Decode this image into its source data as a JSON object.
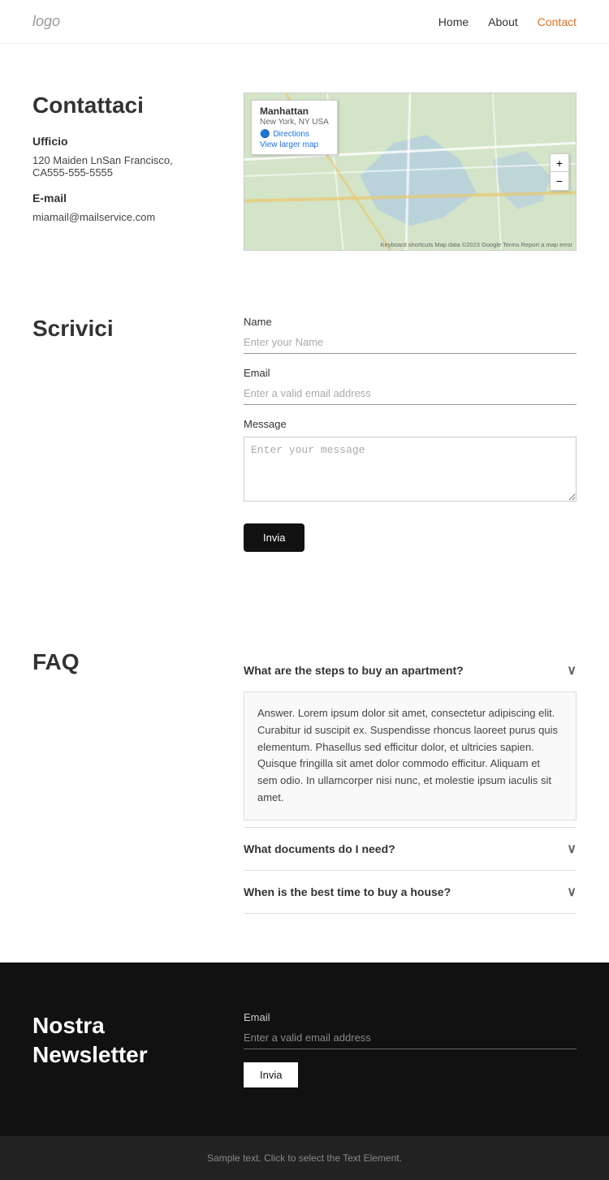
{
  "nav": {
    "logo": "logo",
    "links": [
      {
        "label": "Home",
        "href": "#",
        "active": false
      },
      {
        "label": "About",
        "href": "#",
        "active": false
      },
      {
        "label": "Contact",
        "href": "#",
        "active": true
      }
    ]
  },
  "contact": {
    "title": "Contattaci",
    "office_label": "Ufficio",
    "address": "120 Maiden LnSan Francisco, CA555-555-5555",
    "email_label": "E-mail",
    "email": "miamail@mailservice.com",
    "map": {
      "place": "Manhattan",
      "location": "New York, NY USA",
      "directions_label": "Directions",
      "view_larger": "View larger map",
      "zoom_in": "+",
      "zoom_out": "−",
      "footer": "Keyboard shortcuts  Map data ©2023 Google  Terms  Report a map error"
    }
  },
  "form": {
    "title": "Scrivici",
    "name_label": "Name",
    "name_placeholder": "Enter your Name",
    "email_label": "Email",
    "email_placeholder": "Enter a valid email address",
    "message_label": "Message",
    "message_placeholder": "Enter your message",
    "submit_label": "Invia"
  },
  "faq": {
    "title": "FAQ",
    "items": [
      {
        "question": "What are the steps to buy an apartment?",
        "answer": "Answer. Lorem ipsum dolor sit amet, consectetur adipiscing elit. Curabitur id suscipit ex. Suspendisse rhoncus laoreet purus quis elementum. Phasellus sed efficitur dolor, et ultricies sapien. Quisque fringilla sit amet dolor commodo efficitur. Aliquam et sem odio. In ullamcorper nisi nunc, et molestie ipsum iaculis sit amet.",
        "open": true
      },
      {
        "question": "What documents do I need?",
        "answer": "",
        "open": false
      },
      {
        "question": "When is the best time to buy a house?",
        "answer": "",
        "open": false
      }
    ]
  },
  "newsletter": {
    "title_line1": "Nostra",
    "title_line2": "Newsletter",
    "email_label": "Email",
    "email_placeholder": "Enter a valid email address",
    "submit_label": "Invia"
  },
  "footer": {
    "text": "Sample text. Click to select the Text Element."
  }
}
